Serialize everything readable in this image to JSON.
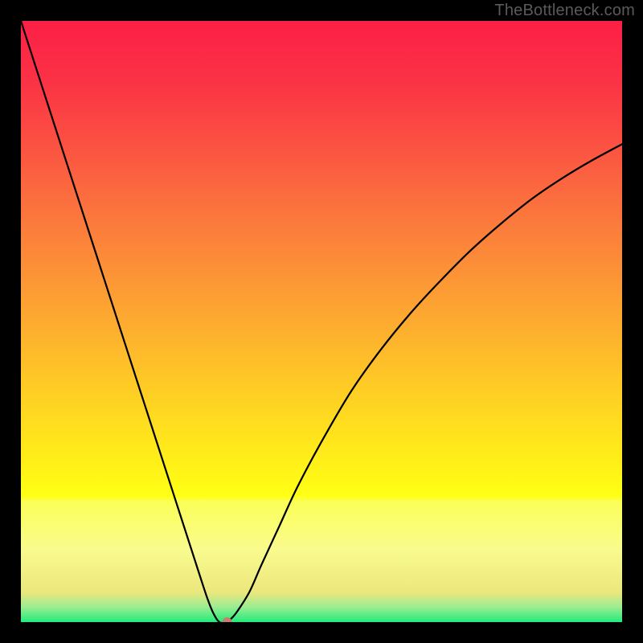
{
  "watermark": "TheBottleneck.com",
  "chart_data": {
    "type": "line",
    "title": "",
    "xlabel": "",
    "ylabel": "",
    "xlim": [
      0,
      100
    ],
    "ylim": [
      0,
      100
    ],
    "x": [
      0,
      5,
      10,
      15,
      20,
      25,
      28,
      30,
      31,
      32,
      33,
      34,
      35,
      36,
      38,
      40,
      43,
      46,
      50,
      55,
      60,
      65,
      70,
      75,
      80,
      85,
      90,
      95,
      100
    ],
    "values": [
      100,
      84.5,
      69,
      53.5,
      38,
      22.5,
      13.2,
      7.0,
      4.0,
      1.5,
      0.0,
      0.0,
      0.6,
      1.8,
      5.0,
      9.5,
      16.0,
      22.5,
      30.0,
      38.5,
      45.5,
      51.6,
      57.0,
      62.0,
      66.4,
      70.4,
      73.8,
      76.8,
      79.5
    ],
    "marker": {
      "x": 34.3,
      "y": 0.0,
      "color": "#c2816f",
      "radius_px": 6
    },
    "background_gradient": {
      "type": "vertical",
      "stops": [
        {
          "pos": 0.0,
          "color": "#fb1f46"
        },
        {
          "pos": 0.1,
          "color": "#fb3245"
        },
        {
          "pos": 0.2,
          "color": "#fb5042"
        },
        {
          "pos": 0.3,
          "color": "#fb6f3e"
        },
        {
          "pos": 0.4,
          "color": "#fc8d38"
        },
        {
          "pos": 0.5,
          "color": "#fdab30"
        },
        {
          "pos": 0.6,
          "color": "#fec926"
        },
        {
          "pos": 0.7,
          "color": "#ffe61c"
        },
        {
          "pos": 0.79,
          "color": "#ffff14"
        },
        {
          "pos": 0.8,
          "color": "#fbff59"
        },
        {
          "pos": 0.88,
          "color": "#f9fb8e"
        },
        {
          "pos": 0.95,
          "color": "#ece77d"
        },
        {
          "pos": 0.975,
          "color": "#9cec92"
        },
        {
          "pos": 1.0,
          "color": "#20ec7b"
        }
      ]
    }
  }
}
